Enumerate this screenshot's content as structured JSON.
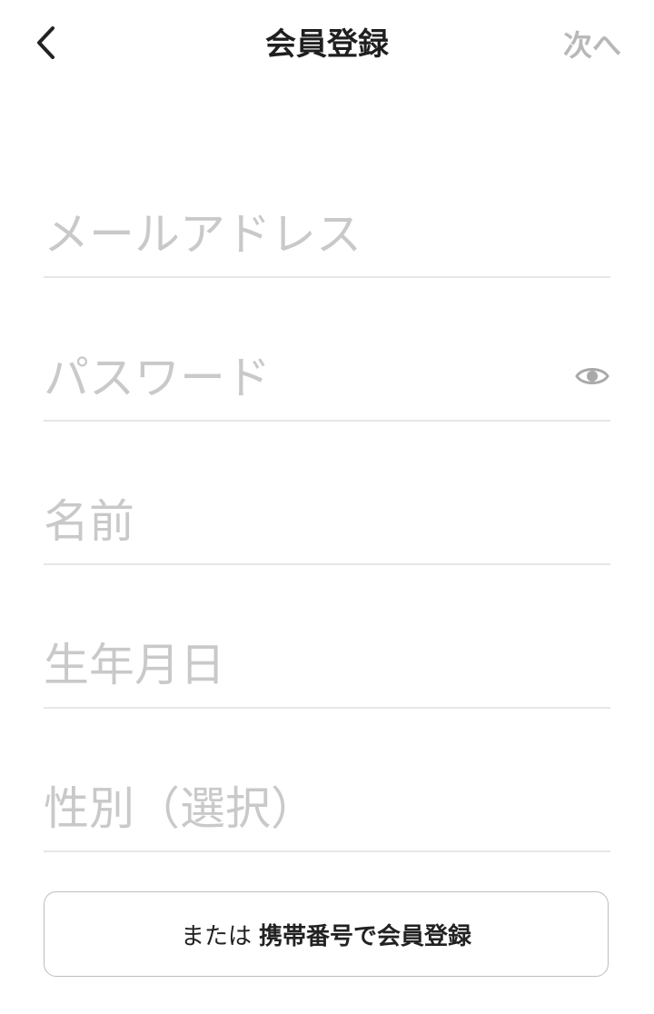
{
  "header": {
    "back_icon": "chevron-left-icon",
    "title": "会員登録",
    "next_label": "次へ"
  },
  "form": {
    "email": {
      "placeholder": "メールアドレス",
      "value": ""
    },
    "password": {
      "placeholder": "パスワード",
      "value": "",
      "toggle_icon": "eye-icon"
    },
    "name": {
      "placeholder": "名前",
      "value": ""
    },
    "birthdate": {
      "placeholder": "生年月日",
      "value": ""
    },
    "gender": {
      "placeholder": "性別（選択）"
    }
  },
  "alt_register": {
    "prefix": "または",
    "emphasis": "携帯番号で会員登録"
  },
  "colors": {
    "title_text": "#1f1f1f",
    "disabled_next": "#b8b8b8",
    "placeholder": "#c9c9c9",
    "divider": "#e7e7e7",
    "button_border": "#bdbdbd"
  }
}
